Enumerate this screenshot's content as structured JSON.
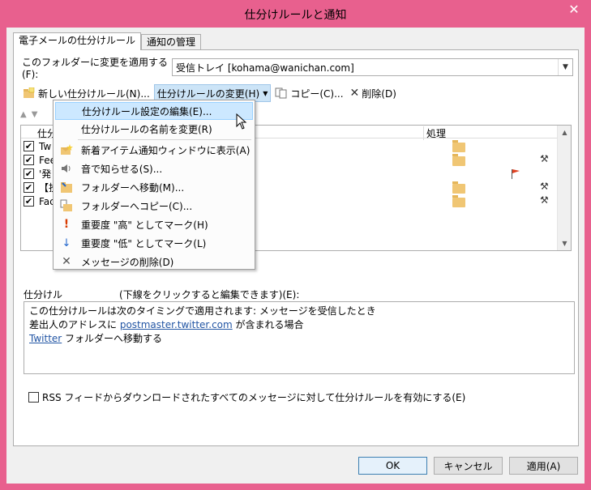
{
  "window": {
    "title": "仕分けルールと通知"
  },
  "tabs": [
    {
      "label": "電子メールの仕分けルール"
    },
    {
      "label": "通知の管理"
    }
  ],
  "folder_row": {
    "label": "このフォルダーに変更を適用する(F):",
    "value": "受信トレイ [kohama@wanichan.com]"
  },
  "toolbar": {
    "new_rule": "新しい仕分けルール(N)...",
    "change_rule": "仕分けルールの変更(H)",
    "copy": "コピー(C)...",
    "delete": "削除(D)"
  },
  "list": {
    "header_name": "仕分",
    "header_action": "処理",
    "rows": [
      {
        "name": "Tw"
      },
      {
        "name": "Fee"
      },
      {
        "name": "'発"
      },
      {
        "name": "【投"
      },
      {
        "name": "Fac"
      }
    ]
  },
  "menu": {
    "items": [
      {
        "label": "仕分けルール設定の編集(E)...",
        "icon": "none"
      },
      {
        "label": "仕分けルールの名前を変更(R)",
        "icon": "none"
      },
      {
        "label": "新着アイテム通知ウィンドウに表示(A)",
        "icon": "envelope-star-icon"
      },
      {
        "label": "音で知らせる(S)...",
        "icon": "speaker-icon"
      },
      {
        "label": "フォルダーへ移動(M)...",
        "icon": "move-folder-icon"
      },
      {
        "label": "フォルダーへコピー(C)...",
        "icon": "copy-folder-icon"
      },
      {
        "label": "重要度 \"高\" としてマーク(H)",
        "icon": "exclamation-icon"
      },
      {
        "label": "重要度 \"低\" としてマーク(L)",
        "icon": "down-arrow-icon"
      },
      {
        "label": "メッセージの削除(D)",
        "icon": "x-icon"
      }
    ]
  },
  "description": {
    "label_visible": "仕分けル",
    "label_tail": "(下線をクリックすると編集できます)(E):",
    "line1": "この仕分けルールは次のタイミングで適用されます: メッセージを受信したとき",
    "line2_pre": "差出人のアドレスに ",
    "line2_link": "postmaster.twitter.com",
    "line2_post": " が含まれる場合",
    "line3_link": "Twitter",
    "line3_post": " フォルダーへ移動する"
  },
  "rss": {
    "label": "RSS フィードからダウンロードされたすべてのメッセージに対して仕分けルールを有効にする(E)"
  },
  "buttons": {
    "ok": "OK",
    "cancel": "キャンセル",
    "apply": "適用(A)"
  },
  "colors": {
    "titlebar": "#e8608e",
    "highlight": "#cce8ff",
    "link": "#2255a4"
  }
}
